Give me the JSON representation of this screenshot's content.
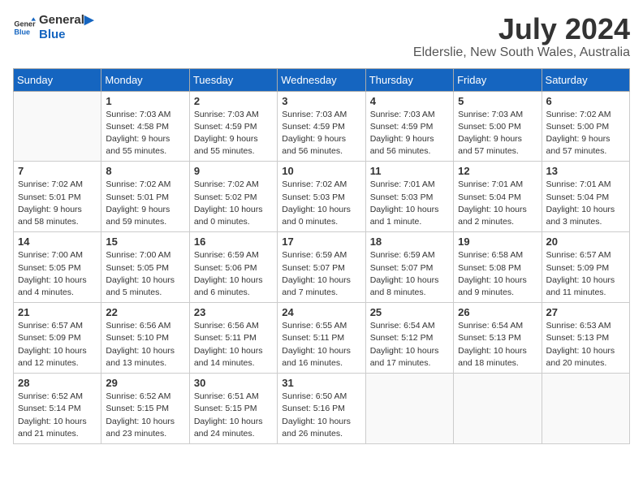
{
  "logo": {
    "line1": "General",
    "line2": "Blue"
  },
  "title": "July 2024",
  "location": "Elderslie, New South Wales, Australia",
  "headers": [
    "Sunday",
    "Monday",
    "Tuesday",
    "Wednesday",
    "Thursday",
    "Friday",
    "Saturday"
  ],
  "weeks": [
    [
      {
        "day": "",
        "info": ""
      },
      {
        "day": "1",
        "info": "Sunrise: 7:03 AM\nSunset: 4:58 PM\nDaylight: 9 hours\nand 55 minutes."
      },
      {
        "day": "2",
        "info": "Sunrise: 7:03 AM\nSunset: 4:59 PM\nDaylight: 9 hours\nand 55 minutes."
      },
      {
        "day": "3",
        "info": "Sunrise: 7:03 AM\nSunset: 4:59 PM\nDaylight: 9 hours\nand 56 minutes."
      },
      {
        "day": "4",
        "info": "Sunrise: 7:03 AM\nSunset: 4:59 PM\nDaylight: 9 hours\nand 56 minutes."
      },
      {
        "day": "5",
        "info": "Sunrise: 7:03 AM\nSunset: 5:00 PM\nDaylight: 9 hours\nand 57 minutes."
      },
      {
        "day": "6",
        "info": "Sunrise: 7:02 AM\nSunset: 5:00 PM\nDaylight: 9 hours\nand 57 minutes."
      }
    ],
    [
      {
        "day": "7",
        "info": "Sunrise: 7:02 AM\nSunset: 5:01 PM\nDaylight: 9 hours\nand 58 minutes."
      },
      {
        "day": "8",
        "info": "Sunrise: 7:02 AM\nSunset: 5:01 PM\nDaylight: 9 hours\nand 59 minutes."
      },
      {
        "day": "9",
        "info": "Sunrise: 7:02 AM\nSunset: 5:02 PM\nDaylight: 10 hours\nand 0 minutes."
      },
      {
        "day": "10",
        "info": "Sunrise: 7:02 AM\nSunset: 5:03 PM\nDaylight: 10 hours\nand 0 minutes."
      },
      {
        "day": "11",
        "info": "Sunrise: 7:01 AM\nSunset: 5:03 PM\nDaylight: 10 hours\nand 1 minute."
      },
      {
        "day": "12",
        "info": "Sunrise: 7:01 AM\nSunset: 5:04 PM\nDaylight: 10 hours\nand 2 minutes."
      },
      {
        "day": "13",
        "info": "Sunrise: 7:01 AM\nSunset: 5:04 PM\nDaylight: 10 hours\nand 3 minutes."
      }
    ],
    [
      {
        "day": "14",
        "info": "Sunrise: 7:00 AM\nSunset: 5:05 PM\nDaylight: 10 hours\nand 4 minutes."
      },
      {
        "day": "15",
        "info": "Sunrise: 7:00 AM\nSunset: 5:05 PM\nDaylight: 10 hours\nand 5 minutes."
      },
      {
        "day": "16",
        "info": "Sunrise: 6:59 AM\nSunset: 5:06 PM\nDaylight: 10 hours\nand 6 minutes."
      },
      {
        "day": "17",
        "info": "Sunrise: 6:59 AM\nSunset: 5:07 PM\nDaylight: 10 hours\nand 7 minutes."
      },
      {
        "day": "18",
        "info": "Sunrise: 6:59 AM\nSunset: 5:07 PM\nDaylight: 10 hours\nand 8 minutes."
      },
      {
        "day": "19",
        "info": "Sunrise: 6:58 AM\nSunset: 5:08 PM\nDaylight: 10 hours\nand 9 minutes."
      },
      {
        "day": "20",
        "info": "Sunrise: 6:57 AM\nSunset: 5:09 PM\nDaylight: 10 hours\nand 11 minutes."
      }
    ],
    [
      {
        "day": "21",
        "info": "Sunrise: 6:57 AM\nSunset: 5:09 PM\nDaylight: 10 hours\nand 12 minutes."
      },
      {
        "day": "22",
        "info": "Sunrise: 6:56 AM\nSunset: 5:10 PM\nDaylight: 10 hours\nand 13 minutes."
      },
      {
        "day": "23",
        "info": "Sunrise: 6:56 AM\nSunset: 5:11 PM\nDaylight: 10 hours\nand 14 minutes."
      },
      {
        "day": "24",
        "info": "Sunrise: 6:55 AM\nSunset: 5:11 PM\nDaylight: 10 hours\nand 16 minutes."
      },
      {
        "day": "25",
        "info": "Sunrise: 6:54 AM\nSunset: 5:12 PM\nDaylight: 10 hours\nand 17 minutes."
      },
      {
        "day": "26",
        "info": "Sunrise: 6:54 AM\nSunset: 5:13 PM\nDaylight: 10 hours\nand 18 minutes."
      },
      {
        "day": "27",
        "info": "Sunrise: 6:53 AM\nSunset: 5:13 PM\nDaylight: 10 hours\nand 20 minutes."
      }
    ],
    [
      {
        "day": "28",
        "info": "Sunrise: 6:52 AM\nSunset: 5:14 PM\nDaylight: 10 hours\nand 21 minutes."
      },
      {
        "day": "29",
        "info": "Sunrise: 6:52 AM\nSunset: 5:15 PM\nDaylight: 10 hours\nand 23 minutes."
      },
      {
        "day": "30",
        "info": "Sunrise: 6:51 AM\nSunset: 5:15 PM\nDaylight: 10 hours\nand 24 minutes."
      },
      {
        "day": "31",
        "info": "Sunrise: 6:50 AM\nSunset: 5:16 PM\nDaylight: 10 hours\nand 26 minutes."
      },
      {
        "day": "",
        "info": ""
      },
      {
        "day": "",
        "info": ""
      },
      {
        "day": "",
        "info": ""
      }
    ]
  ]
}
